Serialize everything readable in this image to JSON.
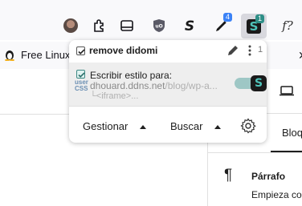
{
  "toolbar": {
    "icons": [
      "avatar",
      "puzzle-icon",
      "sidebar-icon",
      "ublock-icon",
      "s-icon",
      "pen-icon",
      "stylus-icon",
      "fx-icon"
    ],
    "pen_badge": "4",
    "stylus_badge": "1",
    "fx_label": "f?"
  },
  "bookmarks": {
    "item_label": "Free Linux",
    "item_icon": "tux-icon",
    "more_label": "»"
  },
  "popup": {
    "title": "remove didomi",
    "count": "1",
    "entry": {
      "badge_line1": "user",
      "badge_line2": "CSS",
      "title": "Escribir estilo para:",
      "url_domain": "dhouard.ddns.net",
      "url_rest": "/blog/wp-a...",
      "iframe_line": "└<iframe>..."
    },
    "manage_label": "Gestionar",
    "search_label": "Buscar"
  },
  "page": {
    "tab_label": "Bloq",
    "block_symbol": "¶",
    "block_title": "Párrafo",
    "block_desc": "Empieza co"
  },
  "colors": {
    "accent_teal": "#4fc3b9",
    "toggle_track": "#9ec7c5",
    "badge_blue": "#3b82f6"
  }
}
